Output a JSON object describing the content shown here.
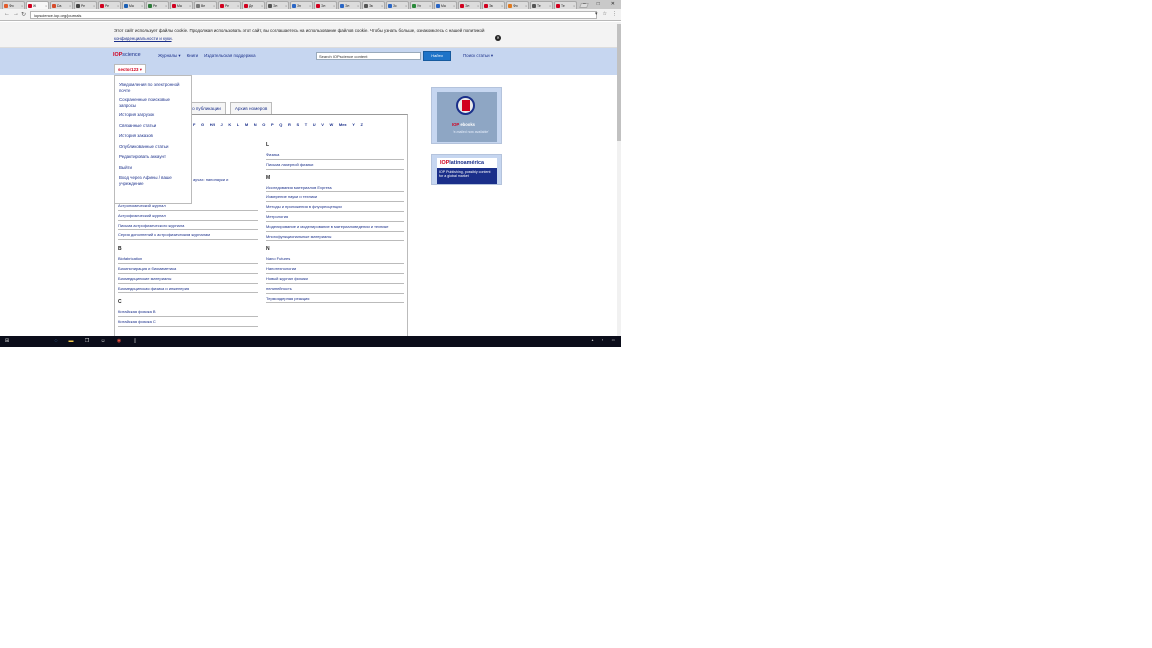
{
  "browser": {
    "tabs": [
      {
        "label": "Фи",
        "color": "#e35b2c"
      },
      {
        "label": "Ж",
        "color": "#d1001f"
      },
      {
        "label": "Da",
        "color": "#d64b2b"
      },
      {
        "label": "Ре",
        "color": "#444"
      },
      {
        "label": "Ре",
        "color": "#d1001f"
      },
      {
        "label": "Ма",
        "color": "#1a5fb4"
      },
      {
        "label": "Ре",
        "color": "#2d7b3a"
      },
      {
        "label": "Ма",
        "color": "#d1001f"
      },
      {
        "label": "Be",
        "color": "#777"
      },
      {
        "label": "Ре",
        "color": "#d1001f"
      },
      {
        "label": "Дн",
        "color": "#d1001f"
      },
      {
        "label": "Эл",
        "color": "#555"
      },
      {
        "label": "Зн",
        "color": "#2a66c5"
      },
      {
        "label": "Эл",
        "color": "#d1001f"
      },
      {
        "label": "Эл",
        "color": "#2a66c5"
      },
      {
        "label": "Эк",
        "color": "#555"
      },
      {
        "label": "Зс",
        "color": "#2a66c5"
      },
      {
        "label": "Ул",
        "color": "#2a8a3a"
      },
      {
        "label": "Ма",
        "color": "#2a66c5"
      },
      {
        "label": "Эл",
        "color": "#d1001f"
      },
      {
        "label": "Эк",
        "color": "#d1001f"
      },
      {
        "label": "Фи",
        "color": "#e07a1f"
      },
      {
        "label": "Те",
        "color": "#555"
      },
      {
        "label": "Те",
        "color": "#d1001f"
      }
    ],
    "active_tab_index": 1,
    "url": "iopscience.iop.org/journals",
    "window_controls": [
      "–",
      "□",
      "✕"
    ]
  },
  "cookie": {
    "text": "Этот сайт использует файлы cookie. Продолжая использовать этот сайт, вы соглашаетесь на использование файлов cookie. Чтобы узнать больше, ознакомьтесь с нашей политикой",
    "link": "конфиденциальности и куки",
    "suffix": "."
  },
  "header": {
    "logo_iop": "IOP",
    "logo_science": "science",
    "nav": [
      "Журналы ▾",
      "Книги",
      "Издательская поддержка"
    ],
    "search_placeholder": "Search IOPscience content",
    "search_button": "Найти",
    "find_articles": "Поиск статьи ▾",
    "user": "sector123 ▾"
  },
  "user_menu": [
    "Уведомления по электронной почте",
    "Сохраненные поисковые запросы",
    "История загрузок",
    "Связанные статьи",
    "История заказов",
    "Опубликованные статьи",
    "Редактировать аккаунт",
    "Выйти",
    "Вход через Афины / ваше учреждение"
  ],
  "content_tabs": [
    "ы по публикации",
    "Архив номеров"
  ],
  "alphabet": [
    "F",
    "G",
    "H/I",
    "J",
    "K",
    "L",
    "M",
    "N",
    "O",
    "P",
    "Q",
    "R",
    "S",
    "T",
    "U",
    "V",
    "W",
    "Мех",
    "Y",
    "Z"
  ],
  "left_fragment": "аучах: нанонауки и",
  "left_column": {
    "items_a": [
      "Астрономический журнал",
      "Астрофизический журнал",
      "Письма астрофизического журнала",
      "Серия дополнений к астрофизическим журналам"
    ],
    "letter_b": "B",
    "items_b": [
      "Biofabrication",
      "Биоинспирация и биомиметика",
      "Биомедицинские материалы",
      "Биомедицинская физика и инженерия"
    ],
    "letter_c": "C",
    "items_c": [
      "Китайская физика B",
      "Китайская физика C"
    ]
  },
  "right_column": {
    "letter_l": "L",
    "items_l": [
      "Физика",
      "Письма лазерной физики"
    ],
    "letter_m": "M",
    "items_m": [
      "Исследования материалов Express",
      "Измерение науки и техники",
      "Методы и приложения в флуоресценции",
      "Метрология",
      "Моделирование и моделирование в материаловедении и технике",
      "Многофункциональные материалы"
    ],
    "letter_n": "N",
    "items_n": [
      "Nano Futures",
      "Нанотехнологии",
      "Новый журнал физики",
      "нелинейность",
      "Термоядерная реакция"
    ]
  },
  "ads": {
    "ebooks_brand_iop": "IOP",
    "ebooks_brand": "ebooks",
    "ebooks_tagline": "'e-mailed now available'",
    "latam_logo_iop": "IOP",
    "latam_logo": "latinoamérica",
    "latam_text": "IOP Publishing, possibly content for a global market"
  }
}
